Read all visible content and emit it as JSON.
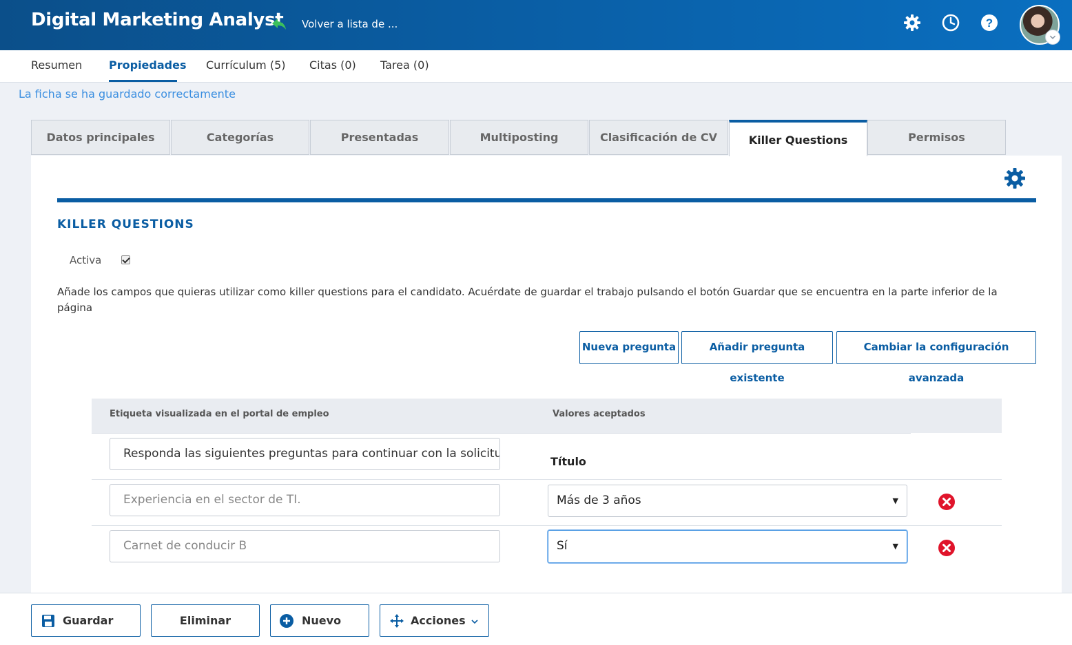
{
  "header": {
    "title": "Digital Marketing Analyst",
    "back_label": "Volver a lista de ..."
  },
  "nav": {
    "items": [
      {
        "label": "Resumen"
      },
      {
        "label": "Propiedades"
      },
      {
        "label": "Currículum (5)"
      },
      {
        "label": "Citas (0)"
      },
      {
        "label": "Tarea (0)"
      }
    ],
    "active": "Propiedades"
  },
  "status_message": "La ficha se ha guardado correctamente",
  "subtabs": {
    "items": [
      {
        "label": "Datos principales"
      },
      {
        "label": "Categorías"
      },
      {
        "label": "Presentadas"
      },
      {
        "label": "Multiposting"
      },
      {
        "label": "Clasificación de CV"
      },
      {
        "label": "Killer Questions"
      },
      {
        "label": "Permisos"
      }
    ],
    "active": "Killer Questions"
  },
  "section": {
    "title": "KILLER QUESTIONS",
    "active_label": "Activa",
    "active_checked": true,
    "description": "Añade los campos que quieras utilizar como killer questions para el candidato. Acuérdate de guardar el trabajo pulsando el botón Guardar que se encuentra en la parte inferior de la página",
    "buttons": {
      "new_question": "Nueva pregunta",
      "add_existing": "Añadir pregunta existente",
      "advanced_config": "Cambiar la configuración avanzada"
    }
  },
  "table": {
    "headers": {
      "label": "Etiqueta visualizada en el portal de empleo",
      "values": "Valores aceptados"
    },
    "rows": [
      {
        "label": "Responda las siguientes preguntas para continuar con la solicitud",
        "value_heading": "Título"
      },
      {
        "label": "Experiencia en el sector de TI.",
        "value": "Más de 3 años"
      },
      {
        "label": "Carnet de conducir B",
        "value": "Sí"
      }
    ]
  },
  "footer": {
    "save": "Guardar",
    "delete": "Eliminar",
    "new": "Nuevo",
    "actions": "Acciones"
  },
  "colors": {
    "brand_blue": "#0a5da3",
    "link_blue": "#3a8ee0",
    "delete_red": "#e0142b"
  }
}
